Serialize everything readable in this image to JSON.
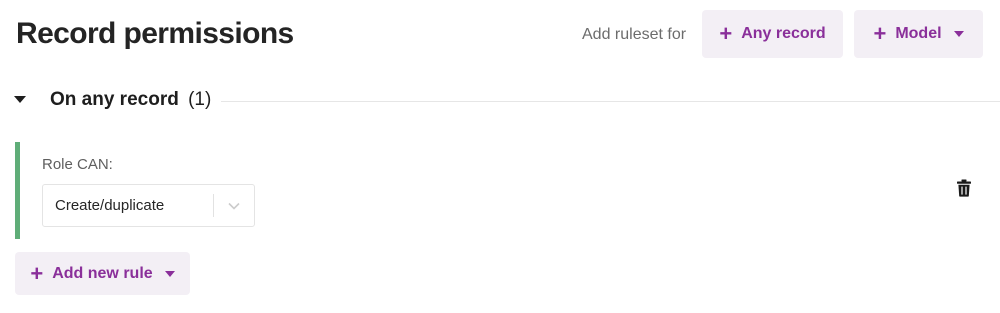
{
  "header": {
    "title": "Record permissions",
    "add_ruleset_for": "Add ruleset for",
    "any_record_label": "Any record",
    "model_label": "Model"
  },
  "section": {
    "name": "On any record",
    "count": "(1)"
  },
  "rule": {
    "role_label": "Role CAN:",
    "action_value": "Create/duplicate"
  },
  "footer": {
    "add_new_rule_label": "Add new rule"
  },
  "icons": {
    "plus": "plus-icon",
    "caret": "caret-down-icon",
    "trash": "trash-icon",
    "chevron": "chevron-down-icon"
  },
  "colors": {
    "accent": "#8a2f9a",
    "button_bg": "#f3eff5",
    "rule_bar": "#5fad78"
  }
}
